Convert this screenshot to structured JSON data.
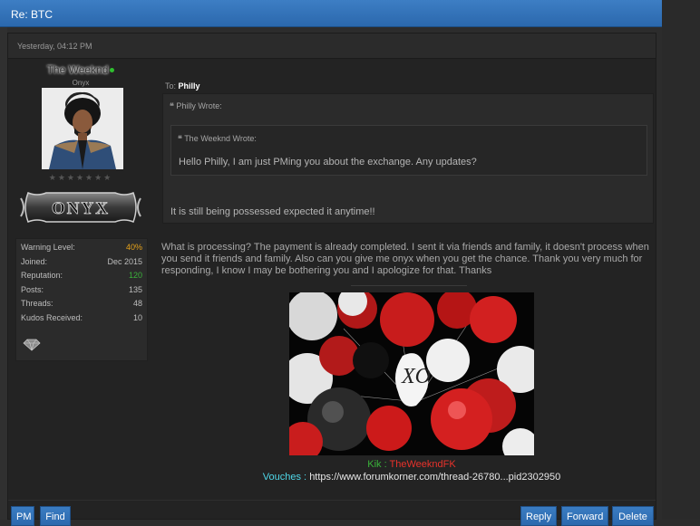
{
  "thread": {
    "title": "Re: BTC"
  },
  "post": {
    "date": "Yesterday, 04:12 PM",
    "author": {
      "username": "The Weeknd",
      "usertitle": "Onyx",
      "stars": "★★★★★★★",
      "badge_text": "ONYX",
      "stats": [
        {
          "label": "Warning Level:",
          "value": "40%",
          "color": "orange"
        },
        {
          "label": "Joined:",
          "value": "Dec 2015",
          "color": ""
        },
        {
          "label": "Reputation:",
          "value": "120",
          "color": "green"
        },
        {
          "label": "Posts:",
          "value": "135",
          "color": ""
        },
        {
          "label": "Threads:",
          "value": "48",
          "color": ""
        },
        {
          "label": "Kudos Received:",
          "value": "10",
          "color": ""
        }
      ]
    },
    "to_label": "To:",
    "to_name": "Philly",
    "quote_outer": {
      "header": "Philly Wrote:",
      "text": "It is still being possessed expected it anytime!!"
    },
    "quote_inner": {
      "header": "The Weeknd Wrote:",
      "text": "Hello Philly, I am just PMing you about the exchange. Any updates?"
    },
    "body": "What is processing? The payment is already completed. I sent it via friends and family, it doesn't process when you send it friends and family. Also can you give me onyx when you get the chance. Thank you very much for responding, I know I may be bothering you and I apologize for that. Thanks",
    "signature": {
      "image_caption": "The Weeknd XO",
      "kik_label": "Kik :",
      "kik_value": "TheWeekndFK",
      "vouches_label": "Vouches :",
      "vouches_value": "https://www.forumkorner.com/thread-26780...pid2302950"
    }
  },
  "buttons": {
    "pm": "PM",
    "find": "Find",
    "reply": "Reply",
    "forward": "Forward",
    "delete": "Delete"
  },
  "colors": {
    "header_blue": "#2b68ad",
    "button_blue": "#2c69ad",
    "warning_orange": "#e6a21a",
    "reputation_green": "#3ab33a",
    "kik_red": "#e8322b",
    "vouches_cyan": "#4fd7e8"
  }
}
